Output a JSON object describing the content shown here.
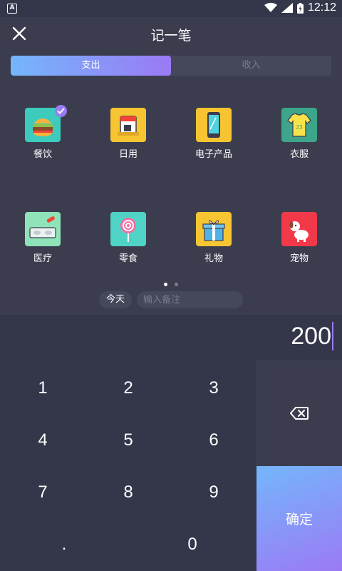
{
  "status": {
    "time": "12:12"
  },
  "header": {
    "title": "记一笔"
  },
  "tabs": [
    {
      "label": "支出",
      "active": true
    },
    {
      "label": "收入",
      "active": false
    }
  ],
  "categories": [
    {
      "label": "餐饮",
      "icon": "burger-icon",
      "selected": true
    },
    {
      "label": "日用",
      "icon": "daily-use-icon"
    },
    {
      "label": "电子产品",
      "icon": "phone-icon"
    },
    {
      "label": "衣服",
      "icon": "shirt-icon"
    },
    {
      "label": "医疗",
      "icon": "pills-icon"
    },
    {
      "label": "零食",
      "icon": "lollipop-icon"
    },
    {
      "label": "礼物",
      "icon": "gift-icon"
    },
    {
      "label": "宠物",
      "icon": "dog-icon"
    }
  ],
  "pager": {
    "pages": 2,
    "current": 1
  },
  "date_chip": "今天",
  "note": {
    "placeholder": "输入备注",
    "value": ""
  },
  "amount": "200",
  "keys": [
    "1",
    "2",
    "3",
    "4",
    "5",
    "6",
    "7",
    "8",
    "9",
    ".",
    "0"
  ],
  "confirm_label": "确定",
  "colors": {
    "accent_start": "#74b6fb",
    "accent_end": "#9b7af5",
    "background": "#3b3d4f"
  }
}
